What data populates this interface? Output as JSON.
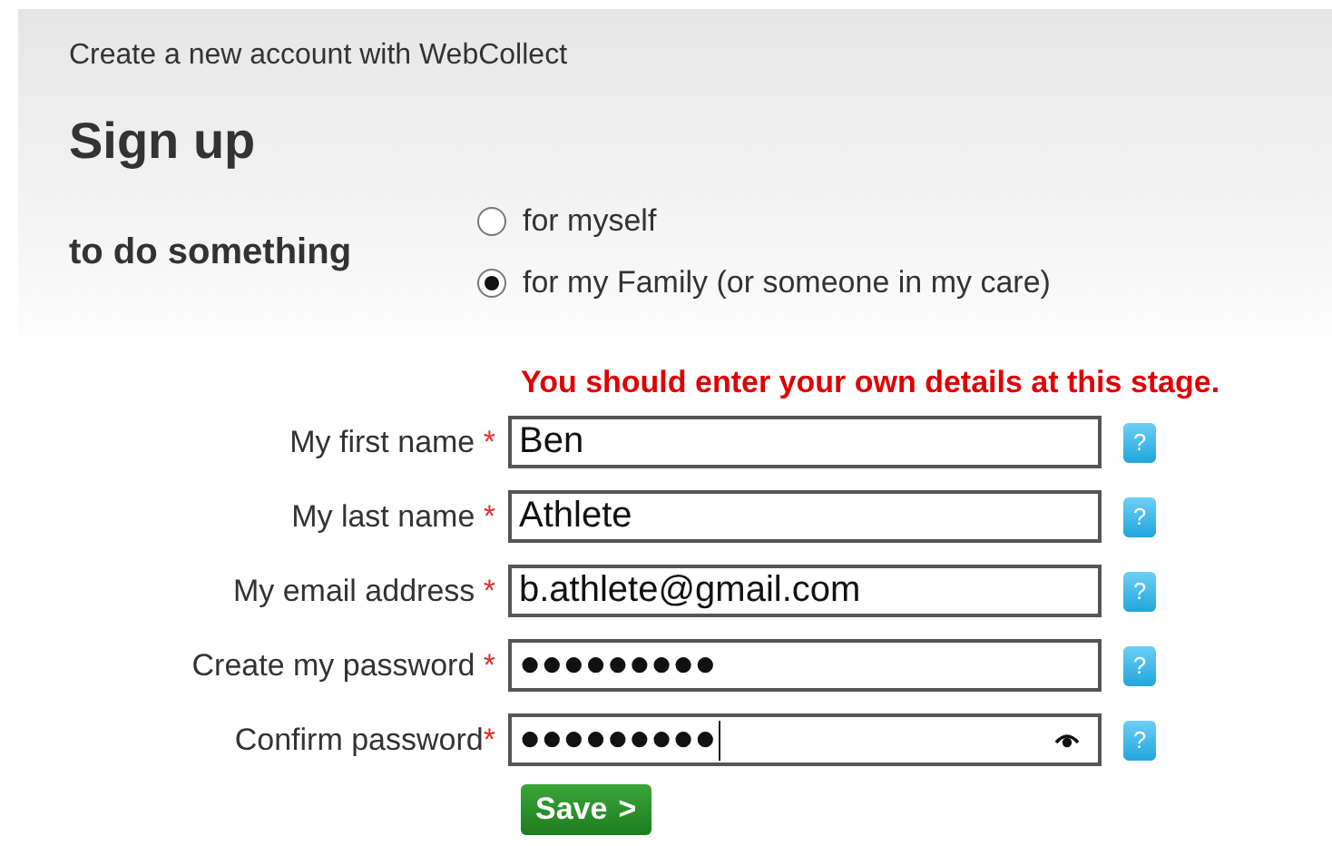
{
  "header": {
    "subtitle": "Create a new account with WebCollect",
    "title": "Sign up"
  },
  "purpose": {
    "label": "to do something",
    "options": [
      {
        "label": "for myself",
        "selected": false
      },
      {
        "label": "for my Family (or someone in my care)",
        "selected": true
      }
    ]
  },
  "warning": "You should enter your own details at this stage.",
  "fields": [
    {
      "label": "My first name",
      "mark": " *",
      "value": "Ben",
      "focused": false,
      "reveal": false
    },
    {
      "label": "My last name",
      "mark": " *",
      "value": "Athlete",
      "focused": false,
      "reveal": false
    },
    {
      "label": "My email address",
      "mark": " *",
      "value": "b.athlete@gmail.com",
      "focused": false,
      "reveal": false
    },
    {
      "label": "Create my password",
      "mark": " *",
      "value": "●●●●●●●●●",
      "focused": false,
      "reveal": false
    },
    {
      "label": "Confirm password",
      "mark": "*",
      "value": "●●●●●●●●●",
      "focused": true,
      "reveal": true
    }
  ],
  "help_mark": "?",
  "save": {
    "label": "Save",
    "arrow": ">"
  }
}
